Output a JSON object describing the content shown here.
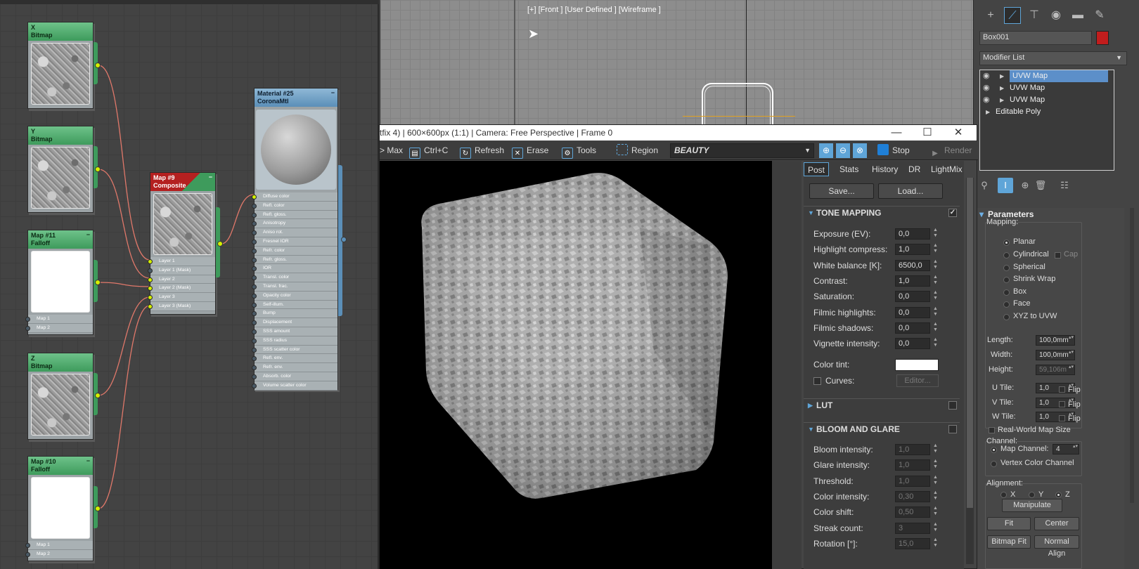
{
  "node_editor": {
    "nodes": [
      {
        "id": "x",
        "title": "X",
        "type": "Bitmap"
      },
      {
        "id": "y",
        "title": "Y",
        "type": "Bitmap"
      },
      {
        "id": "falloff11",
        "title": "Map #11",
        "type": "Falloff",
        "slots": [
          "Map 1",
          "Map 2"
        ]
      },
      {
        "id": "z",
        "title": "Z",
        "type": "Bitmap"
      },
      {
        "id": "falloff10",
        "title": "Map #10",
        "type": "Falloff",
        "slots": [
          "Map 1",
          "Map 2"
        ]
      },
      {
        "id": "composite",
        "title": "Map #9",
        "type": "Composite",
        "slots": [
          "Layer 1",
          "Layer 1 (Mask)",
          "Layer 2",
          "Layer 2 (Mask)",
          "Layer 3",
          "Layer 3 (Mask)"
        ]
      },
      {
        "id": "material",
        "title": "Material #25",
        "type": "CoronaMtl",
        "slots": [
          "Diffuse color",
          "Refl. color",
          "Refl. gloss.",
          "Anisotropy",
          "Aniso rot.",
          "Fresnel IOR",
          "Refr. color",
          "Refr. gloss.",
          "IOR",
          "Transl. color",
          "Transl. frac.",
          "Opacity color",
          "Self-illum.",
          "Bump",
          "Displacement",
          "SSS amount",
          "SSS radius",
          "SSS scatter color",
          "Refl. env.",
          "Refr. env.",
          "Absorb. color",
          "Volume scatter color"
        ]
      }
    ]
  },
  "viewport": {
    "label": "[+] [Front ] [User Defined ] [Wireframe ]"
  },
  "frame_buffer": {
    "title": "tfix 4) | 600×600px (1:1) | Camera: Free Perspective | Frame 0",
    "toolbar": {
      "max": "> Max",
      "copy": "Ctrl+C",
      "refresh": "Refresh",
      "erase": "Erase",
      "tools": "Tools",
      "region": "Region",
      "pass": "BEAUTY",
      "stop": "Stop",
      "render": "Render"
    },
    "tabs": [
      "Post",
      "Stats",
      "History",
      "DR",
      "LightMix"
    ],
    "save": "Save...",
    "load": "Load...",
    "tone_mapping": {
      "title": "TONE MAPPING",
      "checked": true,
      "rows": [
        {
          "label": "Exposure (EV):",
          "value": "0,0"
        },
        {
          "label": "Highlight compress:",
          "value": "1,0"
        },
        {
          "label": "White balance [K]:",
          "value": "6500,0"
        },
        {
          "label": "Contrast:",
          "value": "1,0"
        },
        {
          "label": "Saturation:",
          "value": "0,0"
        },
        {
          "label": "Filmic highlights:",
          "value": "0,0"
        },
        {
          "label": "Filmic shadows:",
          "value": "0,0"
        },
        {
          "label": "Vignette intensity:",
          "value": "0,0"
        }
      ],
      "color_tint": "Color tint:",
      "curves": "Curves:",
      "editor": "Editor..."
    },
    "lut": {
      "title": "LUT"
    },
    "bloom": {
      "title": "BLOOM AND GLARE",
      "rows": [
        {
          "label": "Bloom intensity:",
          "value": "1,0"
        },
        {
          "label": "Glare intensity:",
          "value": "1,0"
        },
        {
          "label": "Threshold:",
          "value": "1,0"
        },
        {
          "label": "Color intensity:",
          "value": "0,30"
        },
        {
          "label": "Color shift:",
          "value": "0,50"
        },
        {
          "label": "Streak count:",
          "value": "3"
        },
        {
          "label": "Rotation [°]:",
          "value": "15,0"
        }
      ]
    }
  },
  "command_panel": {
    "object_name": "Box001",
    "object_color": "#c21d1d",
    "modifier_list": "Modifier List",
    "stack": [
      "UVW Map",
      "UVW Map",
      "UVW Map",
      "Editable Poly"
    ],
    "params": {
      "title": "Parameters",
      "mapping": "Mapping:",
      "options": [
        "Planar",
        "Cylindrical",
        "Spherical",
        "Shrink Wrap",
        "Box",
        "Face",
        "XYZ to UVW"
      ],
      "cap": "Cap",
      "length_label": "Length:",
      "length": "100,0mm",
      "width_label": "Width:",
      "width": "100,0mm",
      "height_label": "Height:",
      "height": "59,106m",
      "utile_label": "U Tile:",
      "utile": "1,0",
      "vtile_label": "V Tile:",
      "vtile": "1,0",
      "wtile_label": "W Tile:",
      "wtile": "1,0",
      "flip": "Flip",
      "realworld": "Real-World Map Size",
      "channel": "Channel:",
      "map_channel_label": "Map Channel:",
      "map_channel": "4",
      "vertex_color": "Vertex Color Channel",
      "alignment": "Alignment:",
      "axes": [
        "X",
        "Y",
        "Z"
      ],
      "manipulate": "Manipulate",
      "fit": "Fit",
      "center": "Center",
      "bitmap_fit": "Bitmap Fit",
      "normal_align": "Normal Align"
    }
  }
}
